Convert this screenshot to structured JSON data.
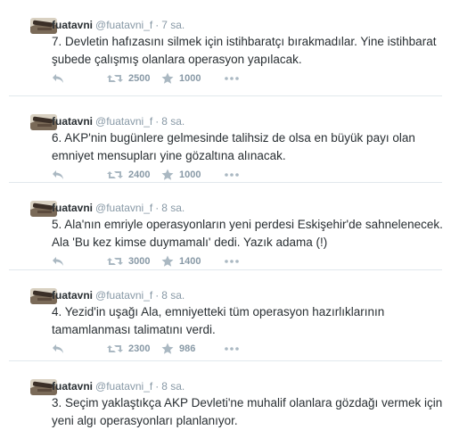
{
  "colors": {
    "text": "#292f33",
    "muted": "#8899a6",
    "icon": "#aab8c2",
    "border": "#e1e8ed"
  },
  "tweets": [
    {
      "fullname": "fuatavni",
      "username": "@fuatavni_f",
      "time": "7 sa.",
      "lines": [
        "7. Devletin hafızasını silmek için istihbaratçı bırakmadılar. Yine istihbarat",
        "şubede çalışmış olanlara operasyon yapılacak."
      ],
      "retweets": "2500",
      "favorites": "1000",
      "icons": [
        "reply-icon",
        "retweet-icon",
        "favorite-icon",
        "more-icon"
      ]
    },
    {
      "fullname": "fuatavni",
      "username": "@fuatavni_f",
      "time": "8 sa.",
      "lines": [
        "6. AKP'nin bugünlere gelmesinde talihsiz de olsa en büyük payı olan",
        "emniyet mensupları yine gözaltına alınacak."
      ],
      "retweets": "2400",
      "favorites": "1000",
      "icons": [
        "reply-icon",
        "retweet-icon",
        "favorite-icon",
        "more-icon"
      ]
    },
    {
      "fullname": "fuatavni",
      "username": "@fuatavni_f",
      "time": "8 sa.",
      "lines": [
        "5. Ala'nın emriyle operasyonların yeni perdesi Eskişehir'de sahnelenecek.",
        "Ala 'Bu kez kimse duymamalı' dedi. Yazık adama (!)"
      ],
      "retweets": "3000",
      "favorites": "1400",
      "icons": [
        "reply-icon",
        "retweet-icon",
        "favorite-icon",
        "more-icon"
      ]
    },
    {
      "fullname": "fuatavni",
      "username": "@fuatavni_f",
      "time": "8 sa.",
      "lines": [
        "4. Yezid'in uşağı Ala, emniyetteki tüm operasyon hazırlıklarının",
        "tamamlanması talimatını verdi."
      ],
      "retweets": "2300",
      "favorites": "986",
      "icons": [
        "reply-icon",
        "retweet-icon",
        "favorite-icon",
        "more-icon"
      ]
    },
    {
      "fullname": "fuatavni",
      "username": "@fuatavni_f",
      "time": "8 sa.",
      "lines": [
        "3. Seçim yaklaştıkça AKP Devleti'ne muhalif olanlara gözdağı vermek için",
        "yeni algı operasyonları planlanıyor."
      ],
      "retweets": "",
      "favorites": "",
      "icons": []
    }
  ]
}
